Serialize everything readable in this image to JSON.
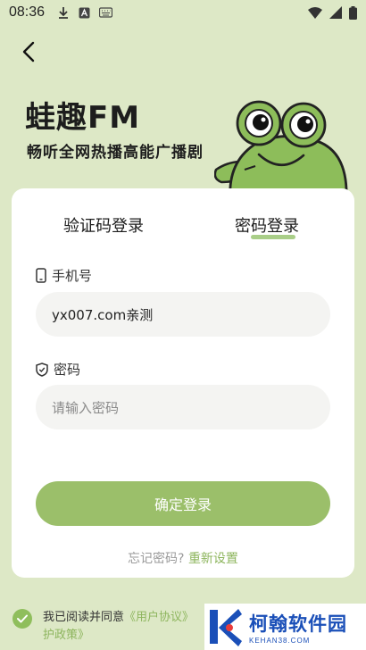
{
  "status_bar": {
    "time": "08:36"
  },
  "brand": {
    "title": "蛙趣FM",
    "subtitle": "畅听全网热播高能广播剧"
  },
  "tabs": [
    {
      "label": "验证码登录"
    },
    {
      "label": "密码登录"
    }
  ],
  "phone_field": {
    "label": "手机号",
    "value": "yx007.com亲测"
  },
  "password_field": {
    "label": "密码",
    "placeholder": "请输入密码"
  },
  "login_button": {
    "label": "确定登录"
  },
  "forgot": {
    "question": "忘记密码?",
    "reset_label": "重新设置"
  },
  "agreement": {
    "text": "我已阅读并同意",
    "user_agreement": "《用户协议》",
    "privacy_tail": "护政策》"
  },
  "watermark": {
    "title": "柯翰软件园",
    "url": "KEHAN38.COM"
  },
  "colors": {
    "background": "#dde8c6",
    "accent": "#9bbf6a",
    "link": "#8db55d"
  },
  "icons": {
    "back": "chevron-left-icon",
    "phone": "phone-icon",
    "shield": "shield-icon",
    "check": "check-icon"
  }
}
